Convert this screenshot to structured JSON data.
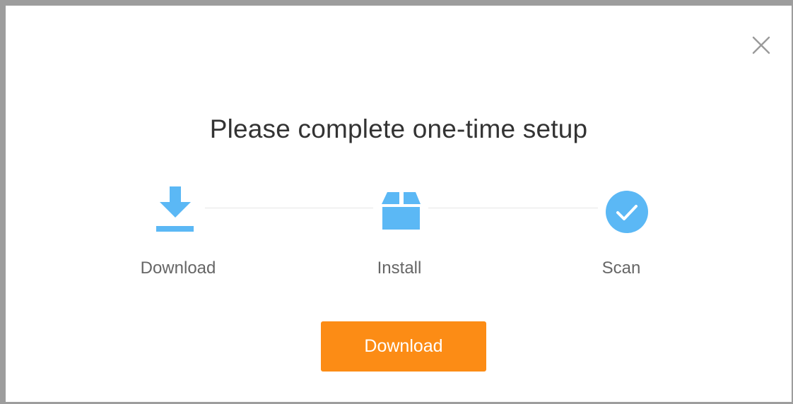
{
  "dialog": {
    "title": "Please complete one-time setup",
    "close_icon": "close-icon",
    "steps": [
      {
        "label": "Download",
        "icon": "download-icon"
      },
      {
        "label": "Install",
        "icon": "package-box-icon"
      },
      {
        "label": "Scan",
        "icon": "check-circle-icon"
      }
    ],
    "action_button_label": "Download"
  },
  "colors": {
    "accent_blue": "#5bb8f5",
    "button_orange": "#fc8c15",
    "title_text": "#333333",
    "label_text": "#666666",
    "connector_line": "#e6e6e6",
    "frame_border": "#9d9d9d"
  }
}
